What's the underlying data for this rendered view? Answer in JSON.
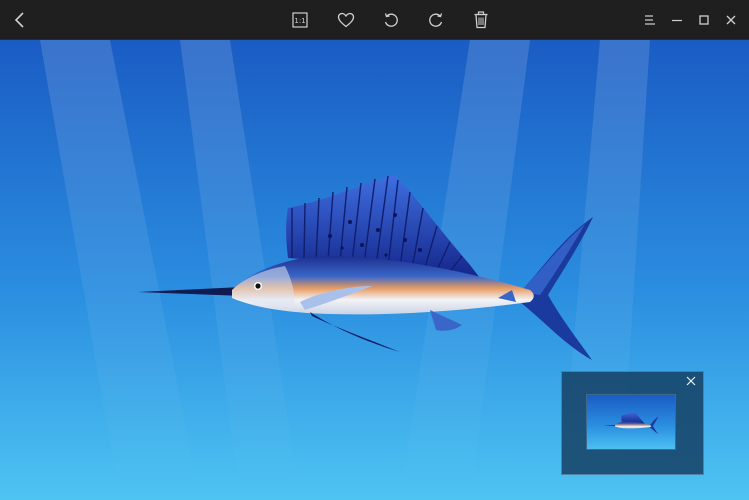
{
  "titlebar": {
    "left_icons": [
      "back-arrow-icon"
    ],
    "center_icons": [
      "actual-size-icon",
      "heart-icon",
      "rotate-left-icon",
      "rotate-right-icon",
      "trash-icon"
    ],
    "right_icons": [
      "menu-icon",
      "minimize-icon",
      "maximize-icon",
      "close-icon"
    ],
    "actual_size_label": "1:1"
  },
  "image": {
    "subject": "sailfish-illustration",
    "background_top": "#1e64c8",
    "background_bottom": "#4cc0f0"
  },
  "navigator": {
    "close_icon": "close-icon",
    "accent": "#2f6fa8"
  },
  "colors": {
    "titlebar_bg": "#1f1f1f",
    "icon_color": "#d0d0d0"
  }
}
